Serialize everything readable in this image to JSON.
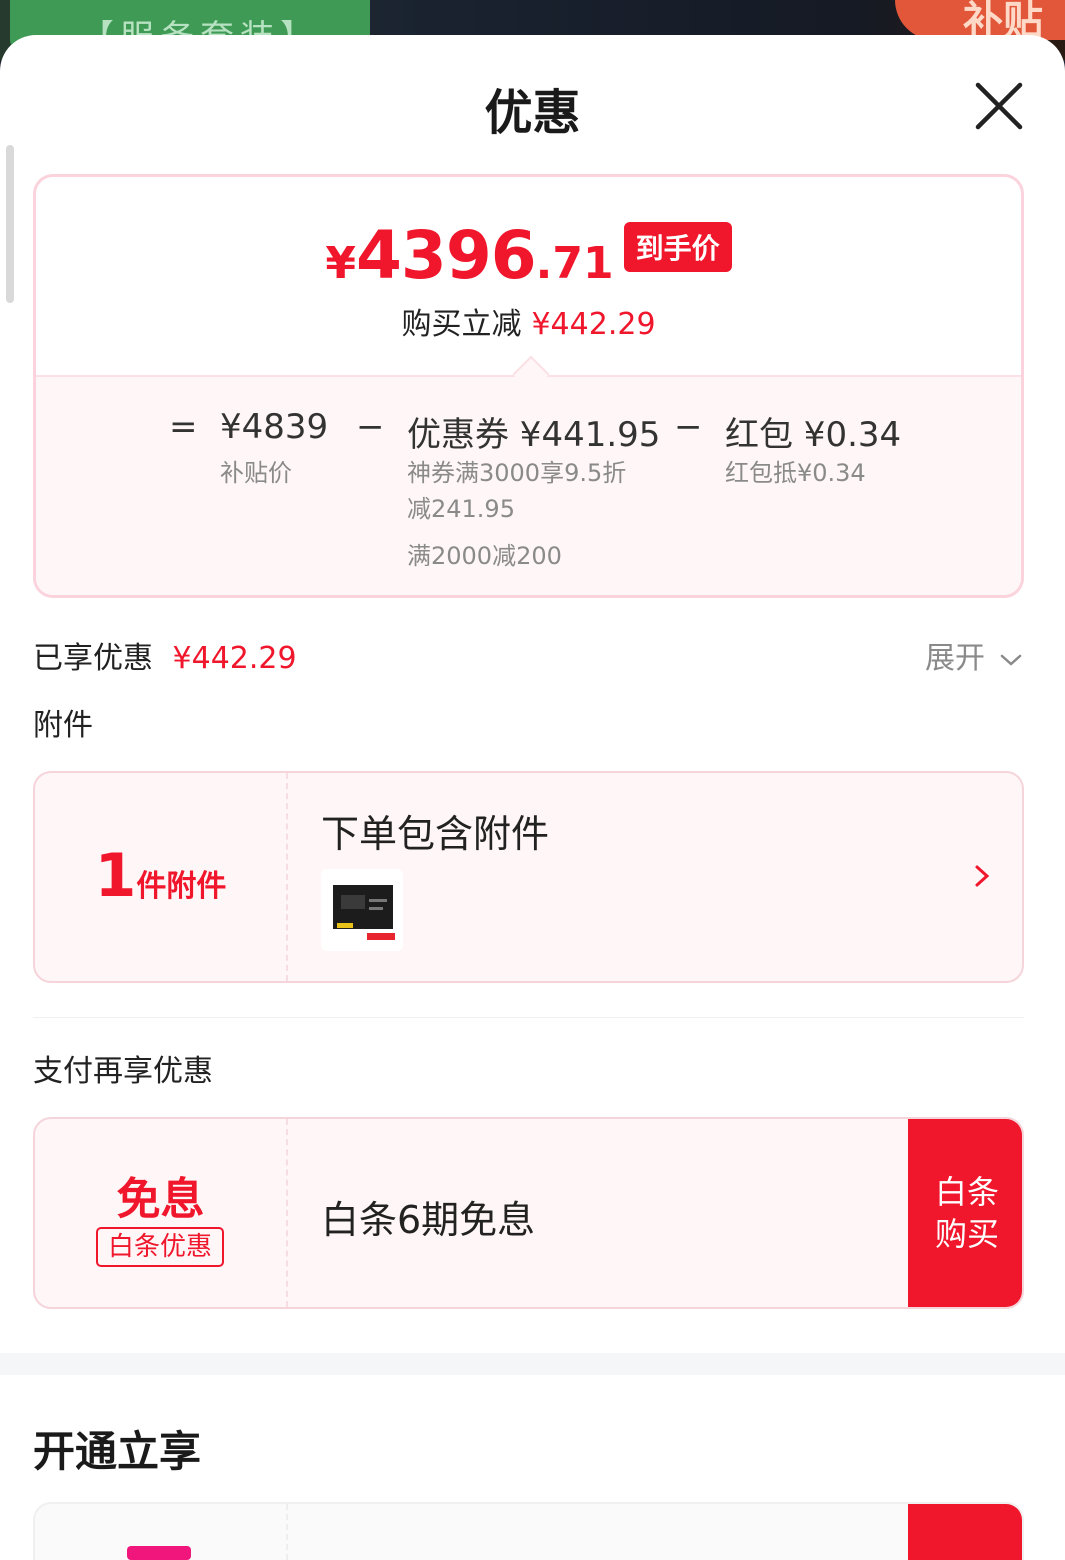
{
  "background": {
    "left_text": "【服务套装】",
    "right_badge": "补贴"
  },
  "sheet": {
    "title": "优惠",
    "close_icon": "close-icon"
  },
  "summary": {
    "final_price": {
      "yen": "¥",
      "int": "4396",
      "dec": ".71",
      "tag": "到手价"
    },
    "reduce_label": "购买立减",
    "reduce_value": "¥442.29",
    "calc": {
      "eq": "=",
      "base_value": "¥4839",
      "base_label": "补贴价",
      "minus1": "−",
      "coupon_title": "优惠券 ¥441.95",
      "coupon_line1": "神券满3000享9.5折",
      "coupon_line2": "减241.95",
      "coupon_line3": "满2000减200",
      "minus2": "−",
      "redpack_title": "红包 ¥0.34",
      "redpack_line1": "红包抵¥0.34"
    }
  },
  "enjoyed": {
    "label": "已享优惠",
    "value": "¥442.29",
    "expand": "展开"
  },
  "accessory": {
    "section": "附件",
    "count": "1",
    "unit": "件附件",
    "title": "下单包含附件"
  },
  "payment": {
    "section": "支付再享优惠",
    "big": "免息",
    "tag": "白条优惠",
    "title": "白条6期免息",
    "btn_line1": "白条",
    "btn_line2": "购买"
  },
  "open": {
    "section": "开通立享"
  },
  "colors": {
    "accent": "#f0162c",
    "card_bg": "#fff6f7",
    "border": "#fbd3dc"
  }
}
